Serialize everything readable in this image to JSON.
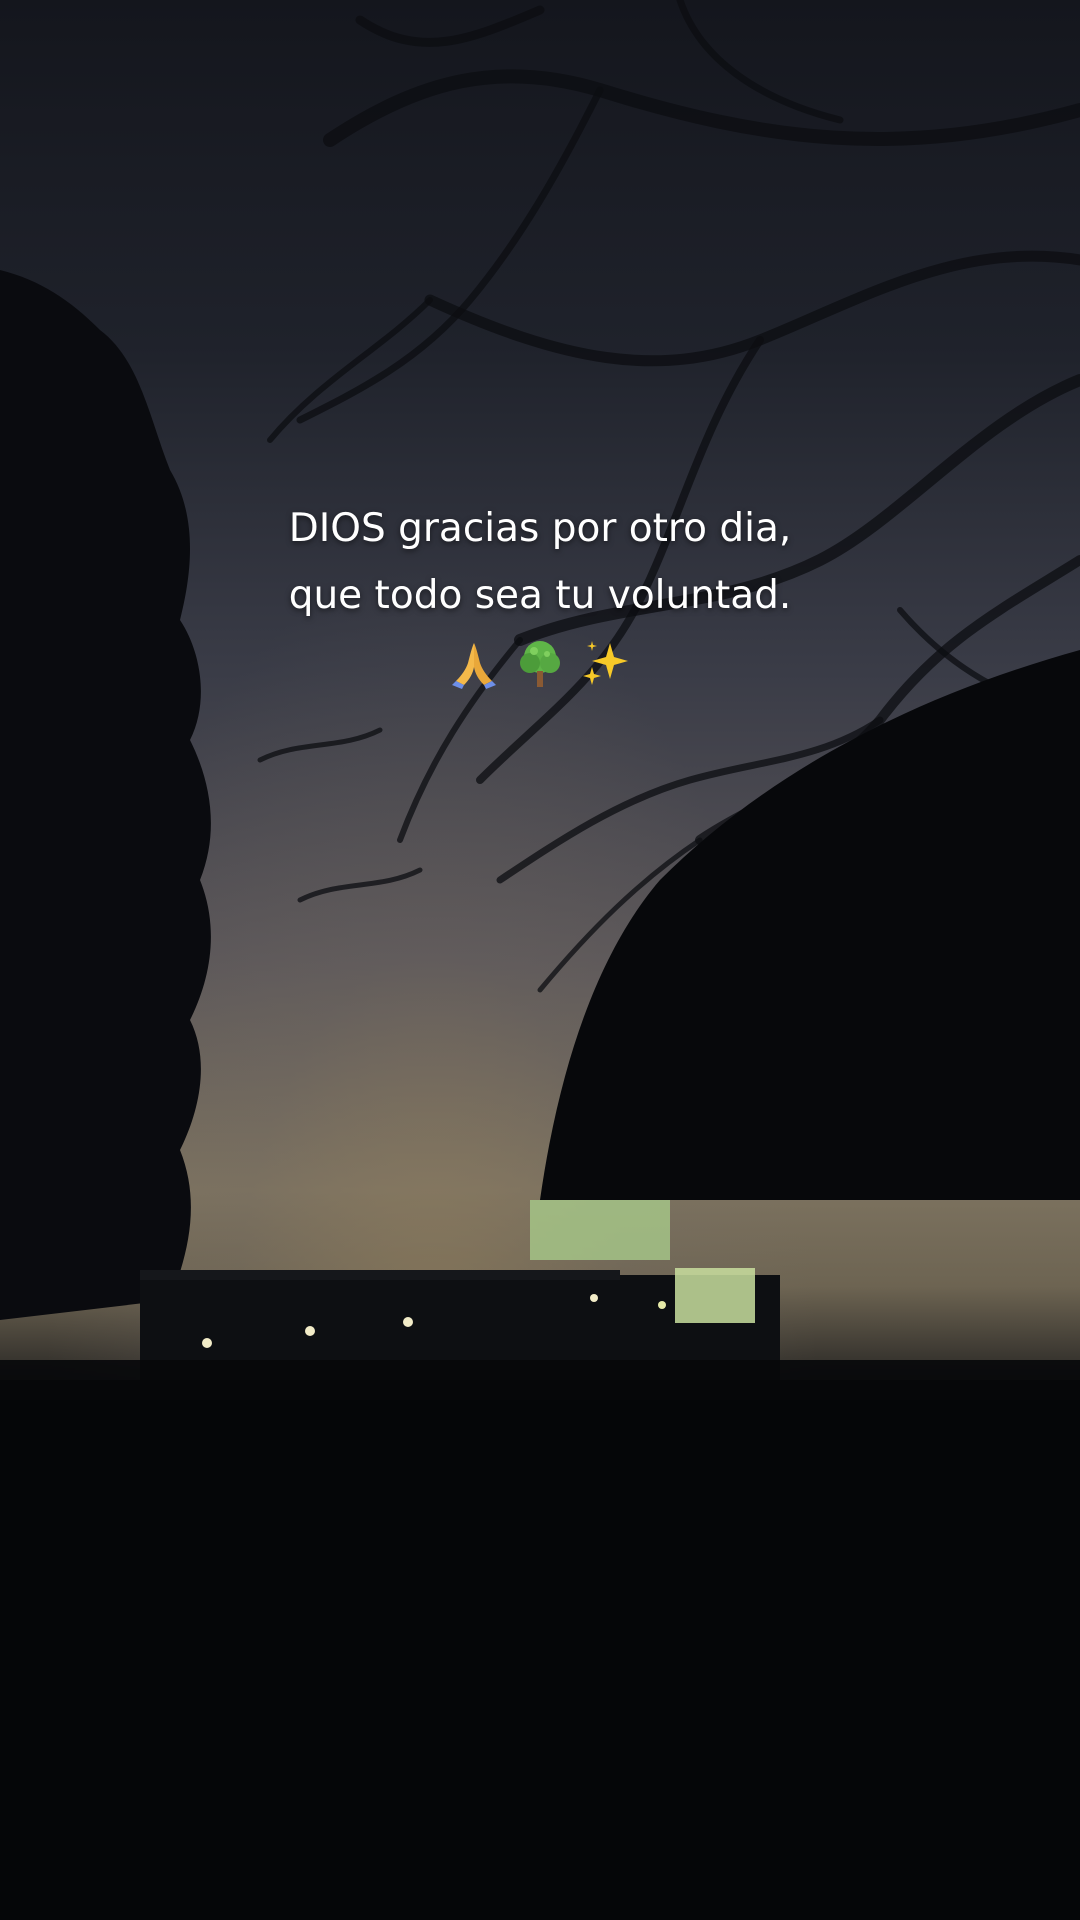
{
  "caption": {
    "line1": "DIOS gracias por otro dia,",
    "line2": "que todo sea tu voluntad.",
    "emojis": [
      "praying-hands-icon",
      "tree-icon",
      "sparkles-icon"
    ]
  },
  "colors": {
    "sky_top": "#14161d",
    "sky_horizon": "#7c725f",
    "foreground": "#050608",
    "lit_window": "#a7c98a",
    "text": "#ffffff"
  }
}
